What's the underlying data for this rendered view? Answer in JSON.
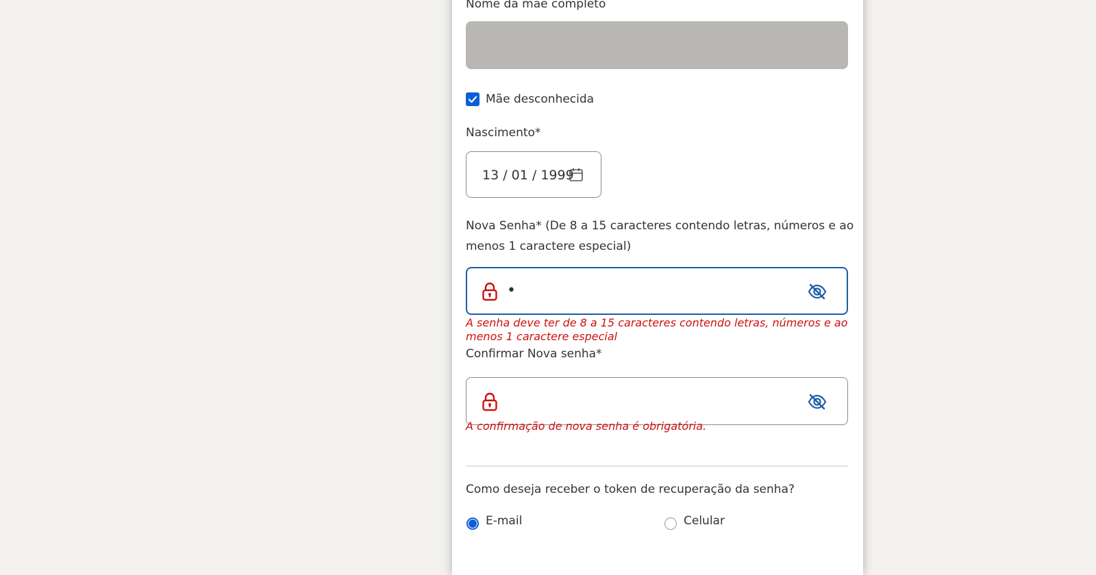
{
  "form": {
    "mother_name_label": "Nome da mãe completo",
    "mother_unknown_label": "Mãe desconhecida",
    "mother_unknown_checked": true,
    "birth_label": "Nascimento*",
    "birth_value": "13 / 01 / 1999",
    "new_password_label_line1": "Nova Senha* (De 8 a 15 caracteres contendo letras, números e ao",
    "new_password_label_line2": "menos 1 caractere especial)",
    "new_password_value": "•",
    "new_password_error_line1": "A senha deve ter de 8 a 15 caracteres contendo letras, números e ao",
    "new_password_error_line2": "menos 1 caractere especial",
    "confirm_password_label": "Confirmar Nova senha*",
    "confirm_password_value": "",
    "confirm_password_error": "A confirmação de nova senha é obrigatória.",
    "token_question": "Como deseja receber o token de recuperação da senha?",
    "token_options": [
      {
        "label": "E-mail",
        "selected": true
      },
      {
        "label": "Celular",
        "selected": false
      }
    ]
  },
  "colors": {
    "accent": "#0b5ed7",
    "error": "#cc1111",
    "lock_icon": "#cc1111",
    "eye_icon": "#1a5ea8",
    "disabled_field": "#b8b7b4",
    "page_background": "#f3f2ef"
  },
  "icons": {
    "checkbox": "check-icon",
    "date": "calendar-icon",
    "password": "lock-icon",
    "visibility": "eye-slash-icon"
  }
}
